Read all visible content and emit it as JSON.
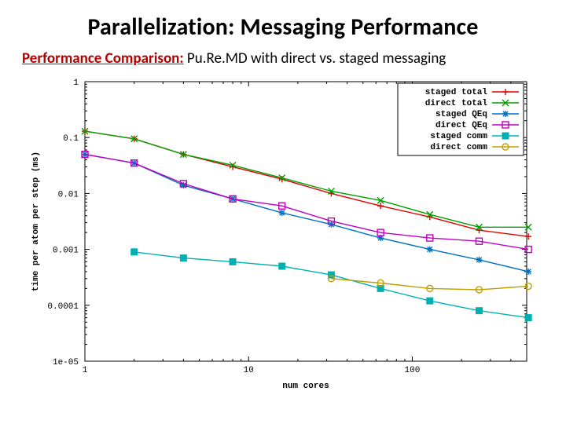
{
  "title": "Parallelization: Messaging Performance",
  "subtitle_leadin": "Performance Comparison:",
  "subtitle_rest": " Pu.Re.MD with direct vs. staged messaging",
  "chart_data": {
    "type": "line",
    "xlabel": "num cores",
    "ylabel": "time per atom per step (ms)",
    "xscale": "log",
    "yscale": "log",
    "xlim": [
      1,
      500
    ],
    "ylim": [
      1e-05,
      1
    ],
    "x_ticks": [
      1,
      10,
      100
    ],
    "y_ticks": [
      1,
      0.1,
      0.01,
      0.001,
      0.0001,
      1e-05
    ],
    "y_tick_labels": [
      "1",
      "0.1",
      "0.01",
      "0.001",
      "0.0001",
      "1e-05"
    ],
    "x": [
      1,
      2,
      4,
      8,
      16,
      32,
      64,
      128,
      256,
      512
    ],
    "series": [
      {
        "name": "staged total",
        "color": "#e00000",
        "marker": "plus",
        "values": [
          0.13,
          0.095,
          0.05,
          0.03,
          0.018,
          0.01,
          0.006,
          0.0038,
          0.0022,
          0.0017
        ]
      },
      {
        "name": "direct total",
        "color": "#00a000",
        "marker": "x",
        "values": [
          0.13,
          0.095,
          0.05,
          0.032,
          0.019,
          0.011,
          0.0075,
          0.0042,
          0.0025,
          0.0025
        ]
      },
      {
        "name": "staged QEq",
        "color": "#0070c0",
        "marker": "star",
        "values": [
          0.05,
          0.035,
          0.014,
          0.008,
          0.0045,
          0.0028,
          0.0016,
          0.001,
          0.00065,
          0.0004
        ]
      },
      {
        "name": "direct QEq",
        "color": "#c000c0",
        "marker": "square",
        "values": [
          0.05,
          0.035,
          0.015,
          0.008,
          0.006,
          0.0032,
          0.002,
          0.0016,
          0.0014,
          0.001
        ]
      },
      {
        "name": "staged comm",
        "color": "#00b0b0",
        "marker": "fsquare",
        "values": [
          null,
          0.0009,
          0.0007,
          0.0006,
          0.0005,
          0.00035,
          0.0002,
          0.00012,
          8e-05,
          6e-05
        ]
      },
      {
        "name": "direct comm",
        "color": "#c0a000",
        "marker": "circle",
        "values": [
          null,
          null,
          null,
          null,
          null,
          0.0003,
          0.00025,
          0.0002,
          0.00019,
          0.00022
        ]
      }
    ],
    "legend_position": "top-right"
  }
}
